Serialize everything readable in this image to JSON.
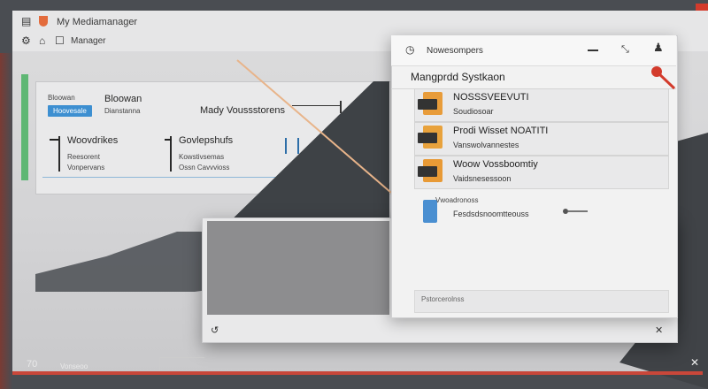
{
  "window": {
    "title": "My Mediamanager",
    "subtitle": "Manager"
  },
  "left_panel": {
    "blue_tag": "Hoovesale",
    "header_label": "Bloowan",
    "header_sub": "Dianstanna",
    "header_right": "Mady Voussstorens",
    "items": [
      {
        "title": "Woovdrikes",
        "line1": "Reesorent",
        "line2": "Vonpervans"
      },
      {
        "title": "Govlepshufs",
        "line1": "Kowstivsemas",
        "line2": "Ossn Cavvvioss"
      }
    ]
  },
  "dialog": {
    "header_label": "Nowesompers",
    "title": "Mangprdd Systkaon",
    "cards": [
      {
        "title": "NOSSSVEEVUTI",
        "sub": "Soudiosoar",
        "color": "#e89c3a"
      },
      {
        "title": "Prodi Wisset NOATITI",
        "sub": "Vanswolvannestes",
        "color": "#e8a23c"
      },
      {
        "title": "Woow Vossboomtiy",
        "sub": "Vaidsnesessoon",
        "color": "#e89a36"
      }
    ],
    "row4": {
      "title": "Vwoadronoss",
      "sub": "Fesdsdsnoomtteouss",
      "color": "#4a8fd1"
    },
    "footer_text": "Pstorcerolnss"
  },
  "bottom": {
    "left_label": "Vonseoo",
    "mid_label": "",
    "sheet_label": "70"
  },
  "colors": {
    "accent_blue": "#3d8fd1",
    "green": "#5fb774",
    "red": "#d33b2c",
    "orange": "#e89c3a"
  },
  "icons": [
    "document-icon",
    "shield-icon",
    "settings-icon",
    "close-icon",
    "pin-icon",
    "user-icon",
    "pen-icon",
    "folder-icon"
  ]
}
